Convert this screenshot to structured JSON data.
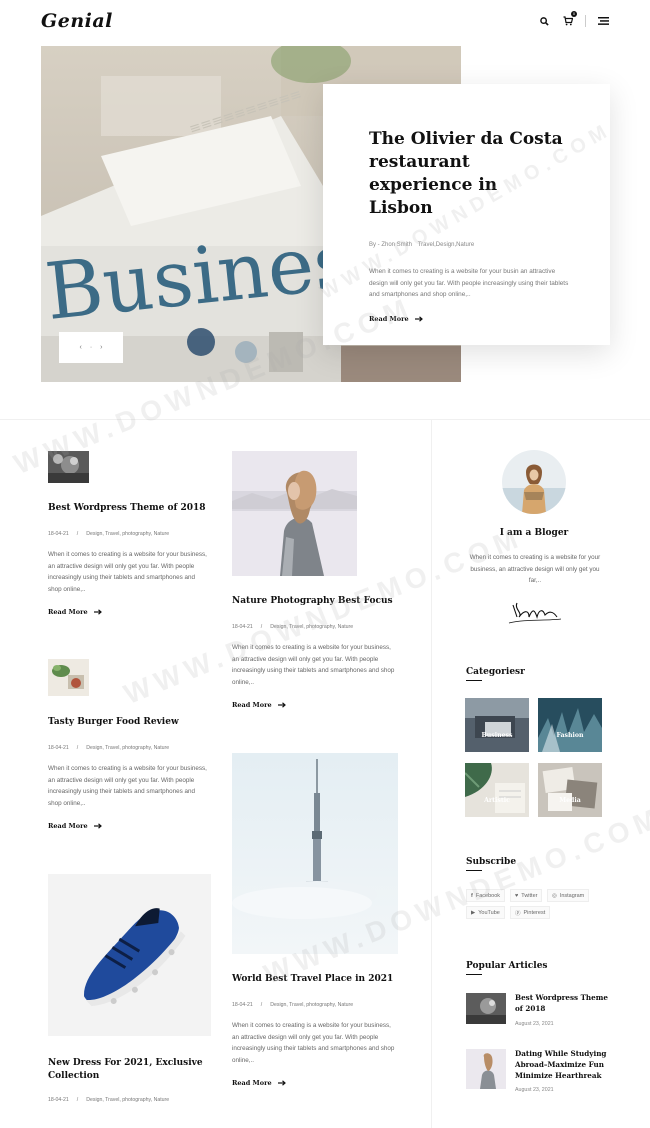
{
  "header": {
    "logo": "Genial",
    "icons": [
      "search-icon",
      "cart-icon",
      "menu-icon"
    ],
    "cart_count": "0"
  },
  "hero": {
    "image_text": "Business",
    "title": "The Olivier da Costa restaurant experience in Lisbon",
    "author": "By - Zhon Smith",
    "categories": "Travel,Design,Nature",
    "excerpt": "When it comes to creating is a website for your busin an attractive design will only get you far. With people increasingly using their tablets and smartphones and shop online,..",
    "read_more": "Read More",
    "nav_prev": "‹",
    "nav_dot": "·",
    "nav_next": "›"
  },
  "posts": [
    {
      "title": "Best Wordpress Theme of 2018",
      "date": "18-04-21",
      "sep": "/",
      "cats": "Design, Travel, photography, Nature",
      "excerpt": "When it comes to creating is a website for your business, an attractive design will only get you far. With people increasingly using their tablets and smartphones and shop online,..",
      "read_more": "Read More"
    },
    {
      "title": "Nature Photography Best Focus",
      "date": "18-04-21",
      "sep": "/",
      "cats": "Design, Travel, photography, Nature",
      "excerpt": "When it comes to creating is a website for your business, an attractive design will only get you far. With people increasingly using their tablets and smartphones and shop online,..",
      "read_more": "Read More"
    },
    {
      "title": "Tasty Burger Food Review",
      "date": "18-04-21",
      "sep": "/",
      "cats": "Design, Travel, photography, Nature",
      "excerpt": "When it comes to creating is a website for your business, an attractive design will only get you far. With people increasingly using their tablets and smartphones and shop online,..",
      "read_more": "Read More"
    },
    {
      "title": "World Best Travel Place in 2021",
      "date": "18-04-21",
      "sep": "/",
      "cats": "Design, Travel, photography, Nature",
      "excerpt": "When it comes to creating is a website for your business, an attractive design will only get you far. With people increasingly using their tablets and smartphones and shop online,..",
      "read_more": "Read More"
    },
    {
      "title": "New Dress For 2021, Exclusive Collection",
      "date": "18-04-21",
      "sep": "/",
      "cats": "Design, Travel, photography, Nature"
    }
  ],
  "sidebar": {
    "about_title": "I am a Bloger",
    "about_text": "When it comes to creating is a website for your business, an attractive design will only get you far,..",
    "signature": "Kinley",
    "categories_title": "Categoriesr",
    "categories": [
      "Business",
      "Fashion",
      "Artistic",
      "Media"
    ],
    "subscribe_title": "Subscribe",
    "social": [
      "Facebook",
      "Twitter",
      "Instagram",
      "YouTube",
      "Pinterest"
    ],
    "popular_title": "Popular Articles",
    "popular": [
      {
        "title": "Best Wordpress Theme of 2018",
        "date": "August 23, 2021"
      },
      {
        "title": "Dating While Studying Abroad–Maximize Fun Minimize Hearthreak",
        "date": "August 23, 2021"
      }
    ]
  },
  "watermark": "WWW.DOWNDEMO.COM",
  "colors": {
    "text": "#111111",
    "muted": "#777777",
    "divider": "#f0f0f0",
    "accent": "#1b4d80"
  }
}
